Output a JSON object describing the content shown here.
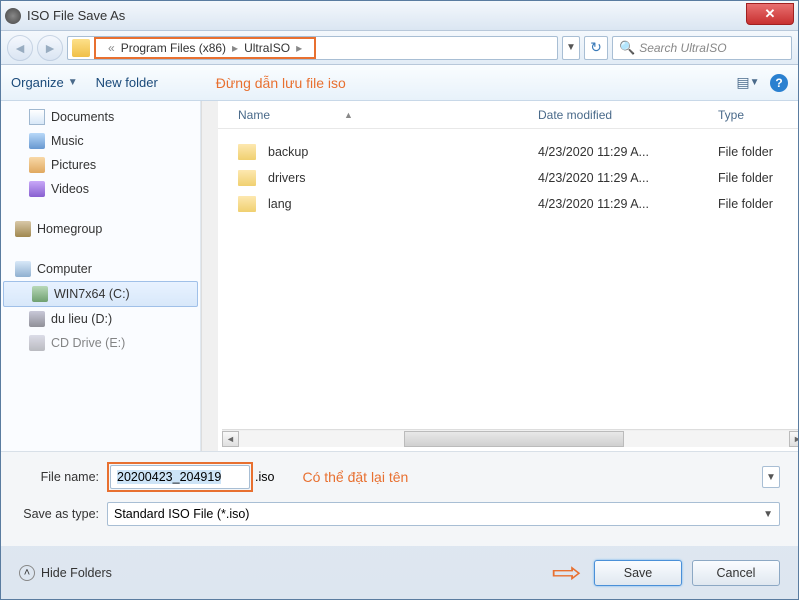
{
  "window": {
    "title": "ISO File Save As"
  },
  "nav": {
    "breadcrumb_prefix": "«",
    "path": [
      "Program Files (x86)",
      "UltraISO"
    ],
    "search_placeholder": "Search UltraISO"
  },
  "toolbar": {
    "organize": "Organize",
    "newfolder": "New folder"
  },
  "annotations": {
    "path_note": "Đừng dẫn lưu file iso",
    "rename_note": "Có thể đặt lại tên"
  },
  "sidebar": {
    "items": [
      {
        "label": "Documents",
        "icon": "doc"
      },
      {
        "label": "Music",
        "icon": "music"
      },
      {
        "label": "Pictures",
        "icon": "pic"
      },
      {
        "label": "Videos",
        "icon": "vid"
      }
    ],
    "homegroup": "Homegroup",
    "computer": "Computer",
    "drives": [
      {
        "label": "WIN7x64 (C:)",
        "icon": "drive",
        "selected": true
      },
      {
        "label": "du lieu (D:)",
        "icon": "drive2",
        "selected": false
      },
      {
        "label": "CD Drive (E:)",
        "icon": "drive2",
        "selected": false
      }
    ]
  },
  "columns": {
    "name": "Name",
    "date": "Date modified",
    "type": "Type"
  },
  "files": [
    {
      "name": "backup",
      "date": "4/23/2020 11:29 A...",
      "type": "File folder"
    },
    {
      "name": "drivers",
      "date": "4/23/2020 11:29 A...",
      "type": "File folder"
    },
    {
      "name": "lang",
      "date": "4/23/2020 11:29 A...",
      "type": "File folder"
    }
  ],
  "form": {
    "filename_label": "File name:",
    "filename_value": "20200423_204919",
    "filename_ext": ".iso",
    "savetype_label": "Save as type:",
    "savetype_value": "Standard ISO File (*.iso)"
  },
  "footer": {
    "hide": "Hide Folders",
    "save": "Save",
    "cancel": "Cancel"
  }
}
